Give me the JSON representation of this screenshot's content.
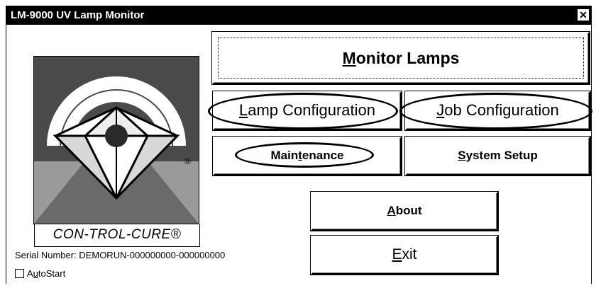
{
  "window": {
    "title": "LM-9000 UV Lamp Monitor",
    "close_glyph": "✕"
  },
  "logo": {
    "caption": "CON-TROL-CURE®",
    "registered_mark": "®"
  },
  "buttons": {
    "monitor": {
      "pre": "",
      "key": "M",
      "post": "onitor Lamps"
    },
    "lamp": {
      "pre": "",
      "key": "L",
      "post": "amp Configuration"
    },
    "job": {
      "pre": "",
      "key": "J",
      "post": "ob Configuration"
    },
    "maintenance": {
      "pre": "Main",
      "key": "t",
      "post": "enance"
    },
    "system": {
      "pre": "",
      "key": "S",
      "post": "ystem Setup"
    },
    "about": {
      "pre": "",
      "key": "A",
      "post": "bout"
    },
    "exit": {
      "pre": "",
      "key": "E",
      "post": "xit"
    }
  },
  "serial_number": "Serial Number: DEMORUN-000000000-000000000",
  "autostart": {
    "pre": "A",
    "key": "u",
    "post": "toStart",
    "checked": false
  },
  "colors": {
    "titlebar": "#000000",
    "background": "#ffffff",
    "logo_gray": "#cfcfcf",
    "logo_dark": "#4a4a4a"
  }
}
